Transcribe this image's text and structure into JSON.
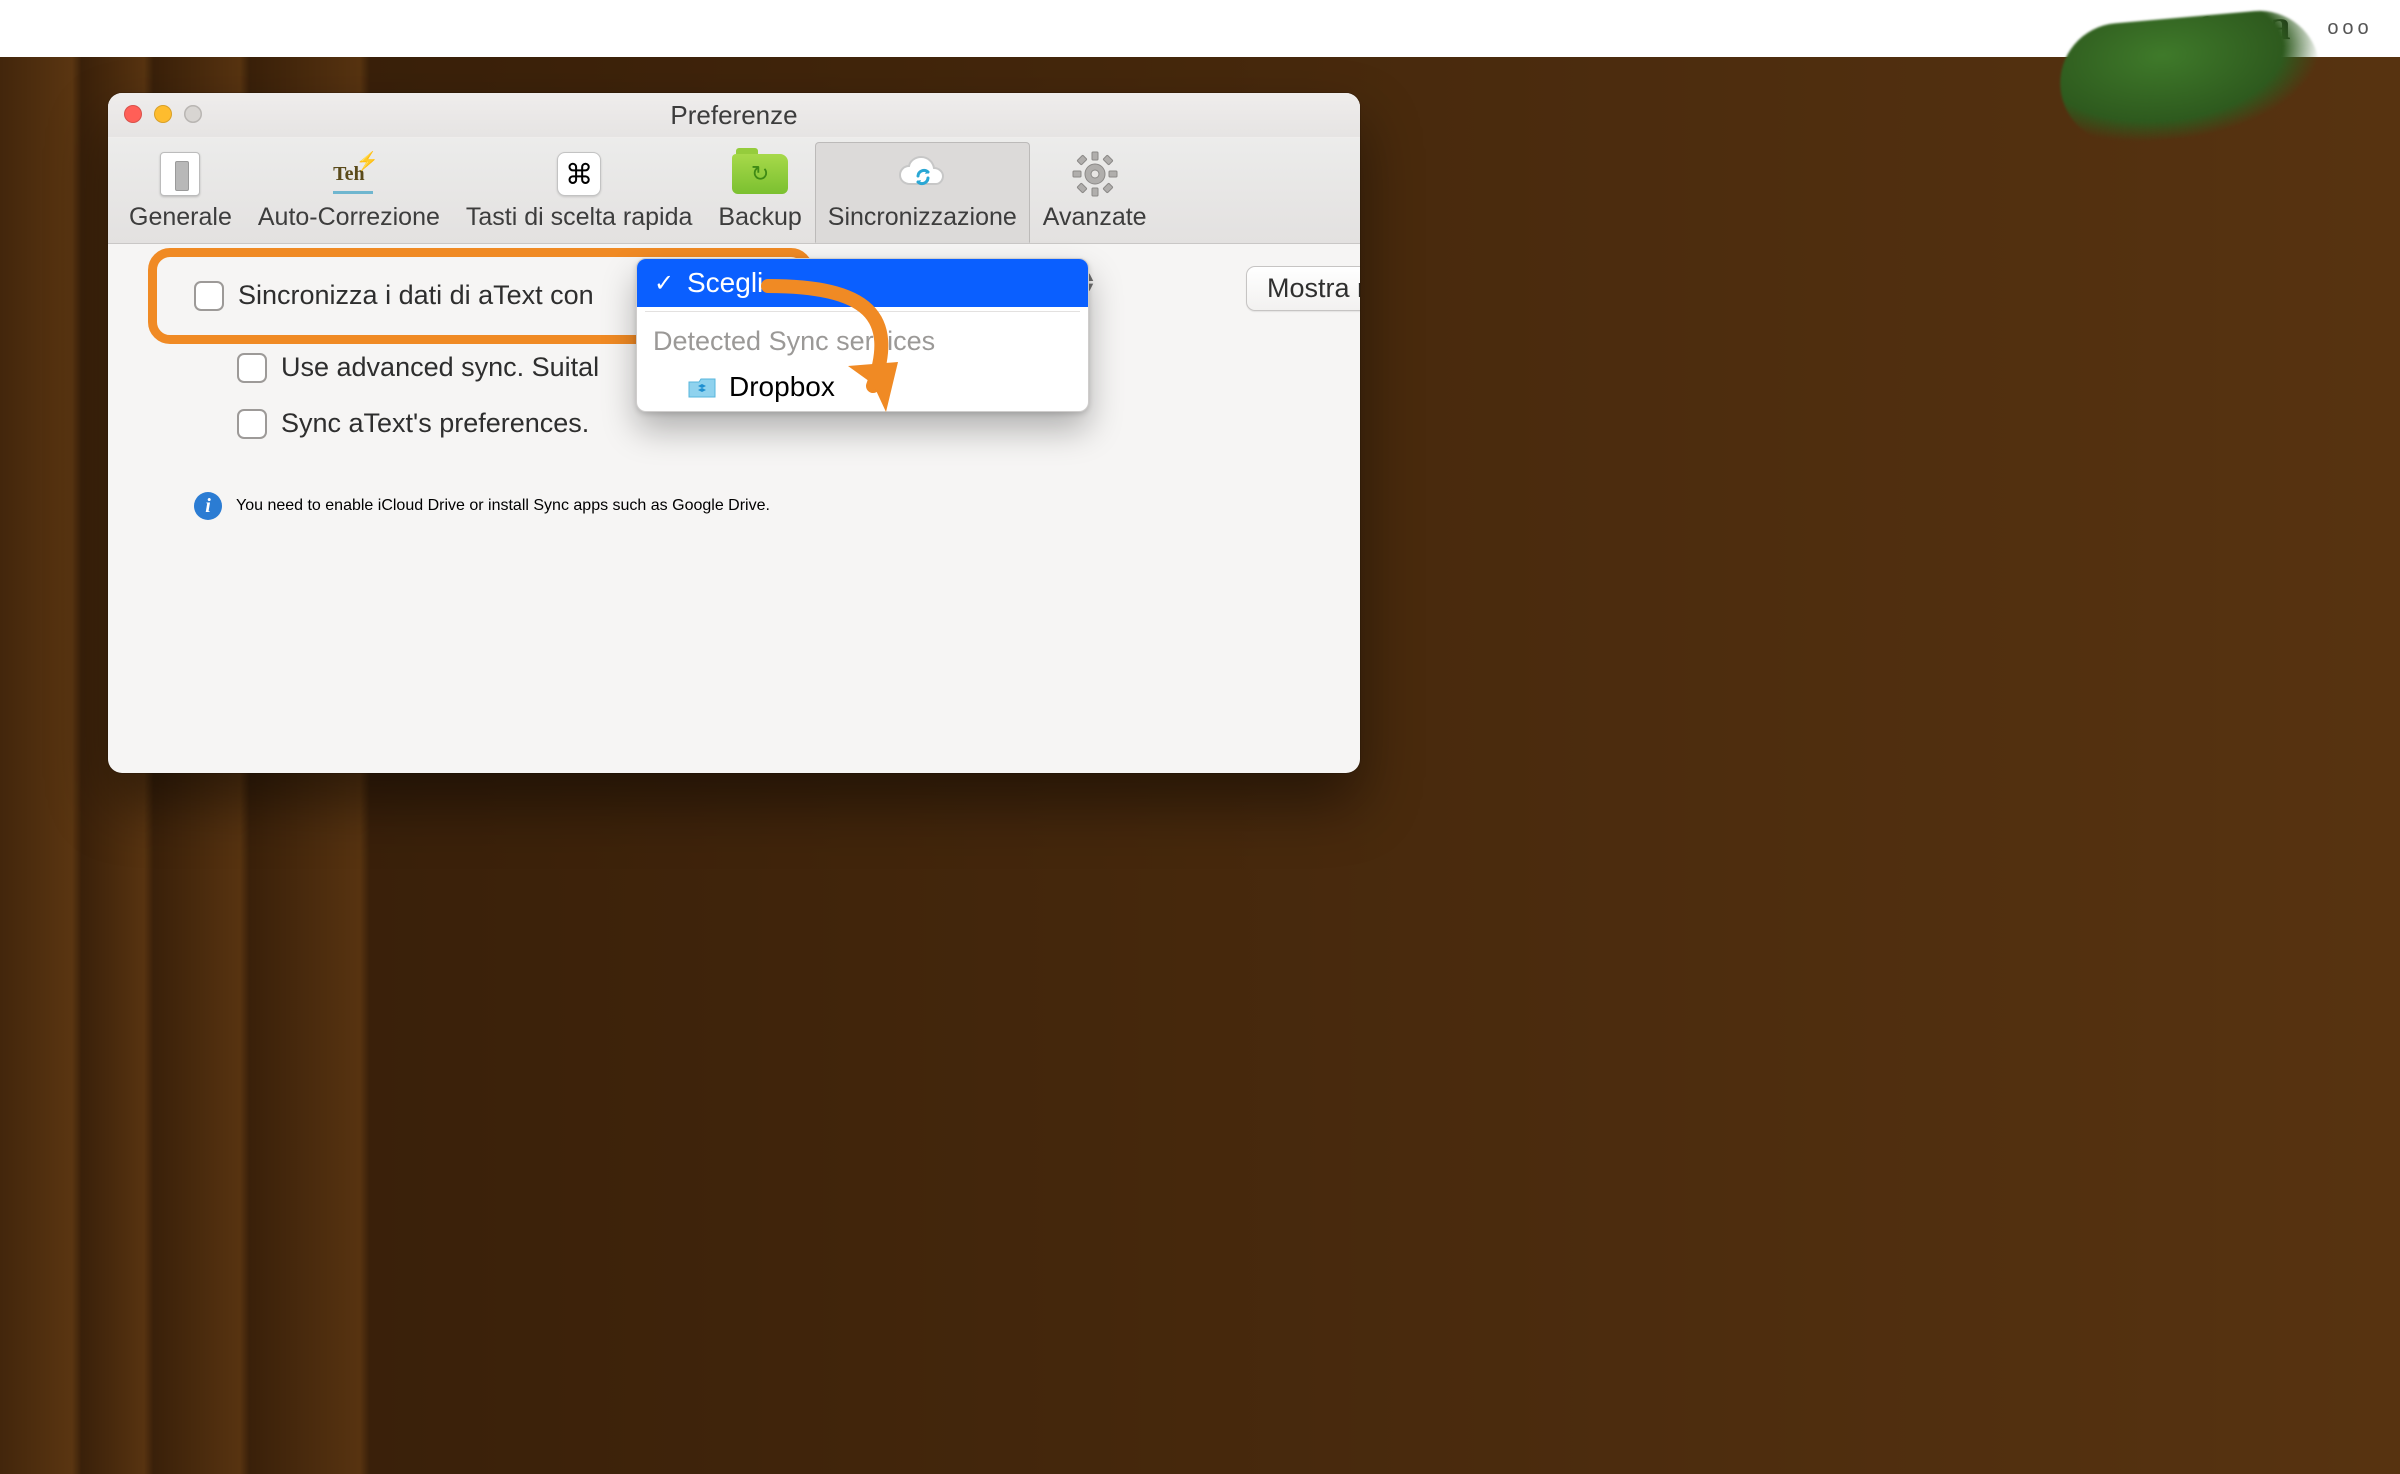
{
  "top_toolbar": {
    "search_icon": "search",
    "cursive_a": "a",
    "more_icon": "ooo"
  },
  "window": {
    "title": "Preferenze"
  },
  "toolbar": {
    "items": [
      {
        "label": "Generale",
        "icon": "switch",
        "selected": false
      },
      {
        "label": "Auto-Correzione",
        "icon": "teh",
        "selected": false
      },
      {
        "label": "Tasti di scelta rapida",
        "icon": "command",
        "selected": false
      },
      {
        "label": "Backup",
        "icon": "folder",
        "selected": false
      },
      {
        "label": "Sincronizzazione",
        "icon": "cloud",
        "selected": true
      },
      {
        "label": "Avanzate",
        "icon": "gear",
        "selected": false
      }
    ]
  },
  "sync_pane": {
    "row1_label": "Sincronizza i dati di aText con",
    "row2_label": "Use advanced sync. Suital",
    "row3_label": "Sync aText's preferences.",
    "info_text": "You need to enable iCloud Drive or install Sync apps such as Google Drive.",
    "show_in_finder_btn": "Mostra nel Finder"
  },
  "dropdown": {
    "selected_label": "Scegli…",
    "section_label": "Detected Sync services",
    "options": [
      {
        "label": "Dropbox",
        "icon": "dropbox-folder"
      }
    ]
  },
  "annotation": {
    "highlight": "sync-data-checkbox-row",
    "arrow_from": "scegli-option",
    "arrow_to": "dropbox-option",
    "color": "#f08a24"
  }
}
